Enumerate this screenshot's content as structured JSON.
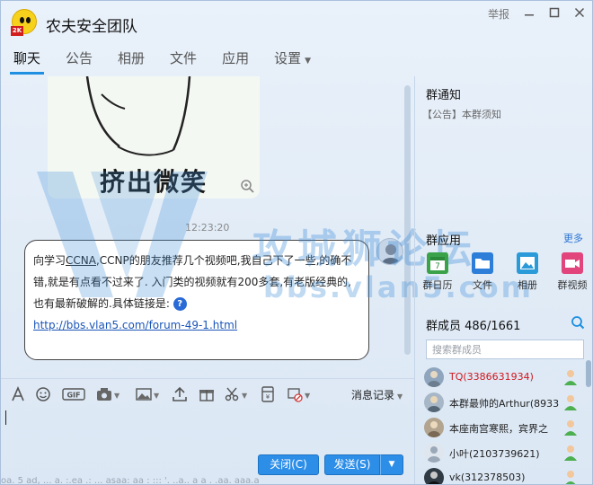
{
  "window": {
    "title": "农夫安全团队",
    "logo_badge": "2K",
    "report_label": "举报",
    "controls": [
      "minimize-icon",
      "maximize-icon",
      "close-icon"
    ]
  },
  "tabs": [
    {
      "label": "聊天",
      "active": true
    },
    {
      "label": "公告",
      "active": false
    },
    {
      "label": "相册",
      "active": false
    },
    {
      "label": "文件",
      "active": false
    },
    {
      "label": "应用",
      "active": false
    },
    {
      "label": "设置",
      "active": false,
      "has_dropdown": true
    }
  ],
  "chat": {
    "sticker_caption": "挤出微笑",
    "timestamp": "12:23:20",
    "message": {
      "p1": "向学习",
      "ccna": "CCNA",
      "p2": ",CCNP的朋友推荐几个视频吧,我自己下了一些,的确不错,就是有点看不过来了. 入门类的视频就有200多套,有老版经典的,也有最新破解的.具体链接是:",
      "link": "http://bbs.vlan5.com/forum-49-1.html"
    }
  },
  "watermark": {
    "text": "攻城狮论坛",
    "url": "bbs.vlan5.com"
  },
  "toolbar": {
    "tools": [
      "font-icon",
      "emoji-icon",
      "gif-icon",
      "screenshot-icon",
      "image-icon",
      "upload-icon",
      "gift-icon",
      "cut-icon",
      "red-packet-icon",
      "disturb-icon"
    ],
    "message_record_label": "消息记录"
  },
  "input": {
    "value": ""
  },
  "buttons": {
    "close_label": "关闭(C)",
    "send_label": "发送(S)"
  },
  "bottom_cut_text": "oa. 5 ad, ... a. :.ea .: ... asaa: aa : ::: '. ..a.. a a . .aa. aaa.a",
  "right": {
    "notice_title": "群通知",
    "notice_text": "【公告】本群须知",
    "apps_title": "群应用",
    "apps_more": "更多",
    "apps": [
      {
        "label": "群日历",
        "icon": "calendar-icon",
        "color": "#3aa34a"
      },
      {
        "label": "文件",
        "icon": "folder-icon",
        "color": "#2d7ed8"
      },
      {
        "label": "相册",
        "icon": "album-icon",
        "color": "#2a9ad9"
      },
      {
        "label": "群视频",
        "icon": "video-icon",
        "color": "#e2457c"
      }
    ],
    "members_title": "群成员 486/1661",
    "search_placeholder": "搜索群成员",
    "members": [
      {
        "name": "TQ(3386631934)",
        "highlight": true
      },
      {
        "name": "本群最帅的Arthur(8933",
        "highlight": false
      },
      {
        "name": "本座南宫寒熙，宾界之",
        "highlight": false
      },
      {
        "name": "小叶(2103739621)",
        "highlight": false
      },
      {
        "name": "vk(312378503)",
        "highlight": false
      }
    ]
  }
}
